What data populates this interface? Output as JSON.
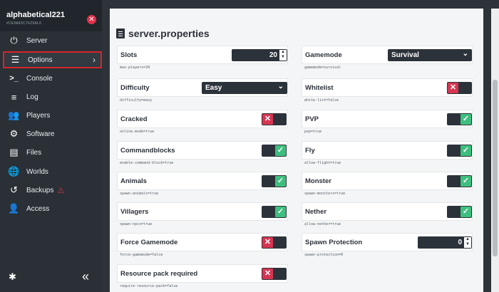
{
  "server": {
    "name": "alphabetical221",
    "id": "#CEIM43C76Z9AL6"
  },
  "nav": [
    {
      "label": "Server"
    },
    {
      "label": "Options"
    },
    {
      "label": "Console"
    },
    {
      "label": "Log"
    },
    {
      "label": "Players"
    },
    {
      "label": "Software"
    },
    {
      "label": "Files"
    },
    {
      "label": "Worlds"
    },
    {
      "label": "Backups"
    },
    {
      "label": "Access"
    }
  ],
  "panel": {
    "title": "server.properties"
  },
  "props": {
    "slots": {
      "label": "Slots",
      "key": "max-players=20",
      "value": "20"
    },
    "gamemode": {
      "label": "Gamemode",
      "key": "gamemode=survival",
      "value": "Survival"
    },
    "difficulty": {
      "label": "Difficulty",
      "key": "difficulty=easy",
      "value": "Easy"
    },
    "whitelist": {
      "label": "Whitelist",
      "key": "white-list=false"
    },
    "cracked": {
      "label": "Cracked",
      "key": "online-mode=true"
    },
    "pvp": {
      "label": "PVP",
      "key": "pvp=true"
    },
    "commandblocks": {
      "label": "Commandblocks",
      "key": "enable-command-block=true"
    },
    "fly": {
      "label": "Fly",
      "key": "allow-flight=true"
    },
    "animals": {
      "label": "Animals",
      "key": "spawn-animals=true"
    },
    "monster": {
      "label": "Monster",
      "key": "spawn-monsters=true"
    },
    "villagers": {
      "label": "Villagers",
      "key": "spawn-npcs=true"
    },
    "nether": {
      "label": "Nether",
      "key": "allow-nether=true"
    },
    "force_gamemode": {
      "label": "Force Gamemode",
      "key": "force-gamemode=false"
    },
    "spawn_protection": {
      "label": "Spawn Protection",
      "key": "spawn-protection=0",
      "value": "0"
    },
    "resource_pack": {
      "label": "Resource pack required",
      "key": "require-resource-pack=false"
    }
  },
  "colors": {
    "on": "#3fbf7f",
    "off": "#d63552",
    "highlight": "#d8232a"
  }
}
